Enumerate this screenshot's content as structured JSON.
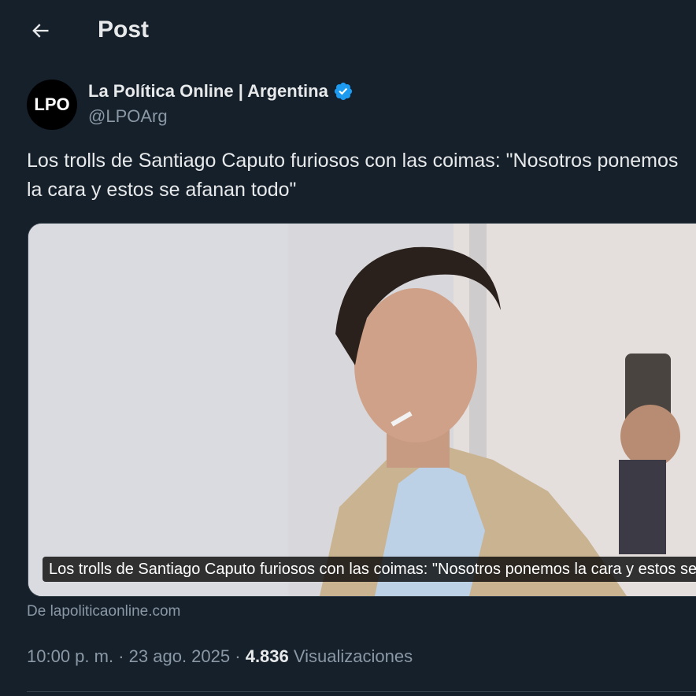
{
  "header": {
    "title": "Post",
    "back_icon": "arrow-left-icon"
  },
  "author": {
    "avatar_text": "LPO",
    "name": "La Política Online | Argentina",
    "handle": "@LPOArg",
    "verified_icon": "verified-badge-icon",
    "verified_color": "#1d9bf0"
  },
  "tweet": {
    "text": "Los trolls de Santiago Caputo furiosos con las coimas: \"Nosotros ponemos la cara y estos se afanan todo\""
  },
  "card": {
    "caption": "Los trolls de Santiago Caputo furiosos con las coimas: \"Nosotros ponemos la cara y estos se afanan todo\"",
    "source": "De lapoliticaonline.com"
  },
  "meta": {
    "time": "10:00 p. m.",
    "separator": "·",
    "date": "23 ago. 2025",
    "views_count": "4.836",
    "views_label": "Visualizaciones"
  },
  "colors": {
    "background": "#15202b",
    "text": "#e7e9ea",
    "muted": "#8b98a5",
    "accent": "#1d9bf0"
  }
}
